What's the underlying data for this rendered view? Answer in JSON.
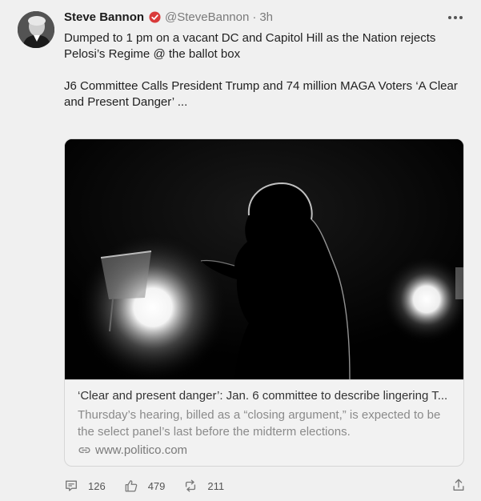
{
  "post": {
    "author_name": "Steve Bannon",
    "author_handle": "@SteveBannon",
    "separator": "·",
    "time_ago": "3h",
    "verified_color": "#e0245e",
    "paragraphs": [
      "Dumped to 1 pm on a vacant DC and Capitol Hill as the Nation rejects Pelosi’s Regime @ the ballot box",
      "J6 Committee Calls President Trump and 74 million MAGA Voters ‘A Clear and Present Danger’ ..."
    ]
  },
  "link_card": {
    "title": "‘Clear and present danger’: Jan. 6 committee to describe lingering T...",
    "description": "Thursday’s hearing, billed as a “closing argument,” is expected to be the select panel’s last before the midterm elections.",
    "domain": "www.politico.com",
    "image_icon": "silhouette-photo"
  },
  "actions": {
    "replies": "126",
    "likes": "479",
    "reposts": "211",
    "reply_icon": "comment-icon",
    "like_icon": "thumbs-up-icon",
    "repost_icon": "repost-icon",
    "share_icon": "share-icon",
    "more_icon": "more-dots-icon"
  }
}
